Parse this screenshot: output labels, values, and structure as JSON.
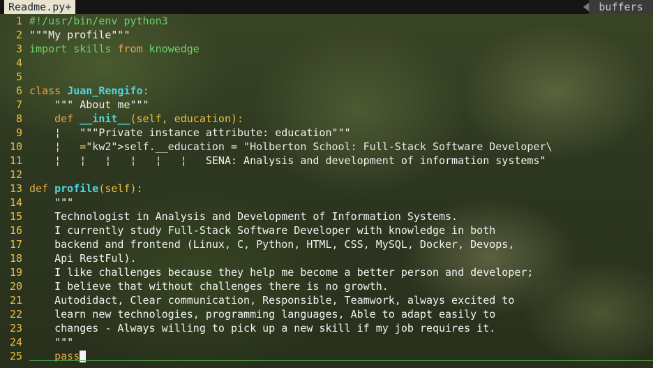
{
  "tab": {
    "active_label": "Readme.py+",
    "buffers_label": "buffers"
  },
  "editor": {
    "lines": [
      {
        "n": "1",
        "text": "#!/usr/bin/env python3"
      },
      {
        "n": "2",
        "text": "\"\"\"My profile\"\"\""
      },
      {
        "n": "3",
        "text": "import skills from knowedge"
      },
      {
        "n": "4",
        "text": ""
      },
      {
        "n": "5",
        "text": ""
      },
      {
        "n": "6",
        "text": "class Juan_Rengifo:"
      },
      {
        "n": "7",
        "text": "    \"\"\" About me\"\"\""
      },
      {
        "n": "8",
        "text": "    def __init__(self, education):"
      },
      {
        "n": "9",
        "text": "    ¦   \"\"\"Private instance attribute: education\"\"\""
      },
      {
        "n": "10",
        "text": "    ¦   self.__education = \"Holberton School: Full-Stack Software Developer\\"
      },
      {
        "n": "11",
        "text": "    ¦   ¦   ¦   ¦   ¦   ¦   SENA: Analysis and development of information systems\""
      },
      {
        "n": "12",
        "text": ""
      },
      {
        "n": "13",
        "text": "def profile(self):"
      },
      {
        "n": "14",
        "text": "    \"\"\""
      },
      {
        "n": "15",
        "text": "    Technologist in Analysis and Development of Information Systems."
      },
      {
        "n": "16",
        "text": "    I currently study Full-Stack Software Developer with knowledge in both"
      },
      {
        "n": "17",
        "text": "    backend and frontend (Linux, C, Python, HTML, CSS, MySQL, Docker, Devops,"
      },
      {
        "n": "18",
        "text": "    Api RestFul)."
      },
      {
        "n": "19",
        "text": "    I like challenges because they help me become a better person and developer;"
      },
      {
        "n": "20",
        "text": "    I believe that without challenges there is no growth."
      },
      {
        "n": "21",
        "text": "    Autodidact, Clear communication, Responsible, Teamwork, always excited to"
      },
      {
        "n": "22",
        "text": "    learn new technologies, programming languages, Able to adapt easily to"
      },
      {
        "n": "23",
        "text": "    changes - Always willing to pick up a new skill if my job requires it."
      },
      {
        "n": "24",
        "text": "    \"\"\""
      },
      {
        "n": "25",
        "text": "    pass"
      }
    ]
  },
  "colors": {
    "line_number": "#f0c040",
    "keyword": "#e6a84a",
    "import_kw": "#6ad36a",
    "class_name": "#52d6e0",
    "status_line": "#4fa84f"
  }
}
